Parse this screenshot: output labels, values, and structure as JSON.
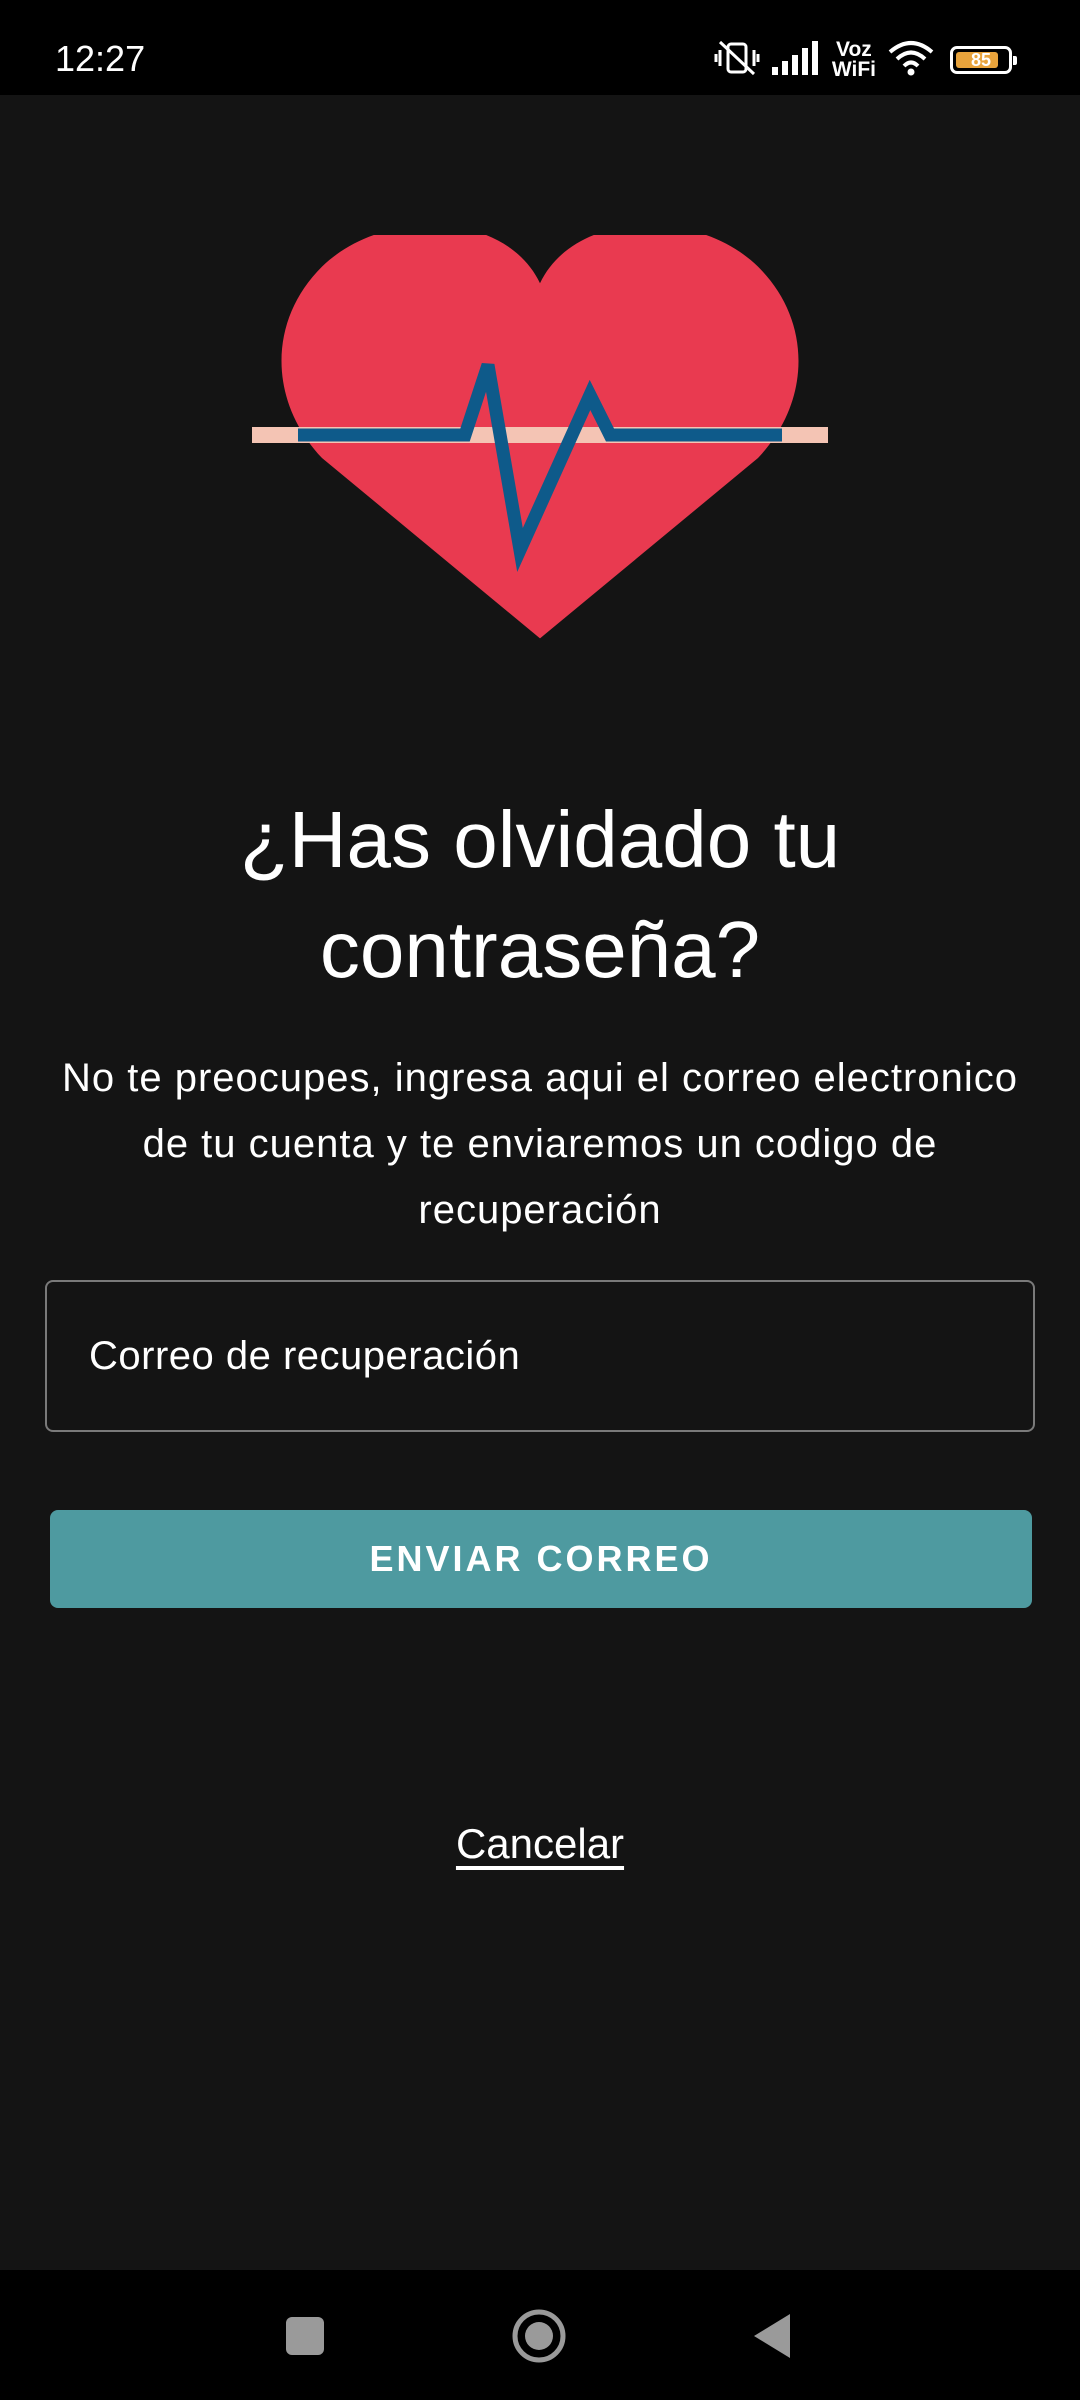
{
  "status_bar": {
    "time": "12:27",
    "network_label_top": "Voz",
    "network_label_bottom": "WiFi",
    "battery_level": 85,
    "battery_text": "85",
    "battery_color": "#e8a33c"
  },
  "icons": {
    "mute": "vibrate-off-icon",
    "signal": "cell-signal-icon",
    "wifi": "wifi-icon",
    "battery": "battery-icon",
    "logo": "heart-pulse-icon"
  },
  "screen": {
    "title": "¿Has olvidado tu contraseña?",
    "subtitle": "No te preocupes, ingresa aqui el correo electronico de tu cuenta y te enviaremos un codigo de recuperación",
    "email_placeholder": "Correo de recuperación",
    "send_button_label": "ENVIAR CORREO",
    "cancel_label": "Cancelar"
  },
  "colors": {
    "background": "#141414",
    "accent": "#4e9aa0",
    "heart": "#e93a50",
    "pulse_line": "#0e5a8a"
  },
  "nav_bar": {
    "recent": "recent-apps-icon",
    "home": "home-icon",
    "back": "back-icon"
  }
}
